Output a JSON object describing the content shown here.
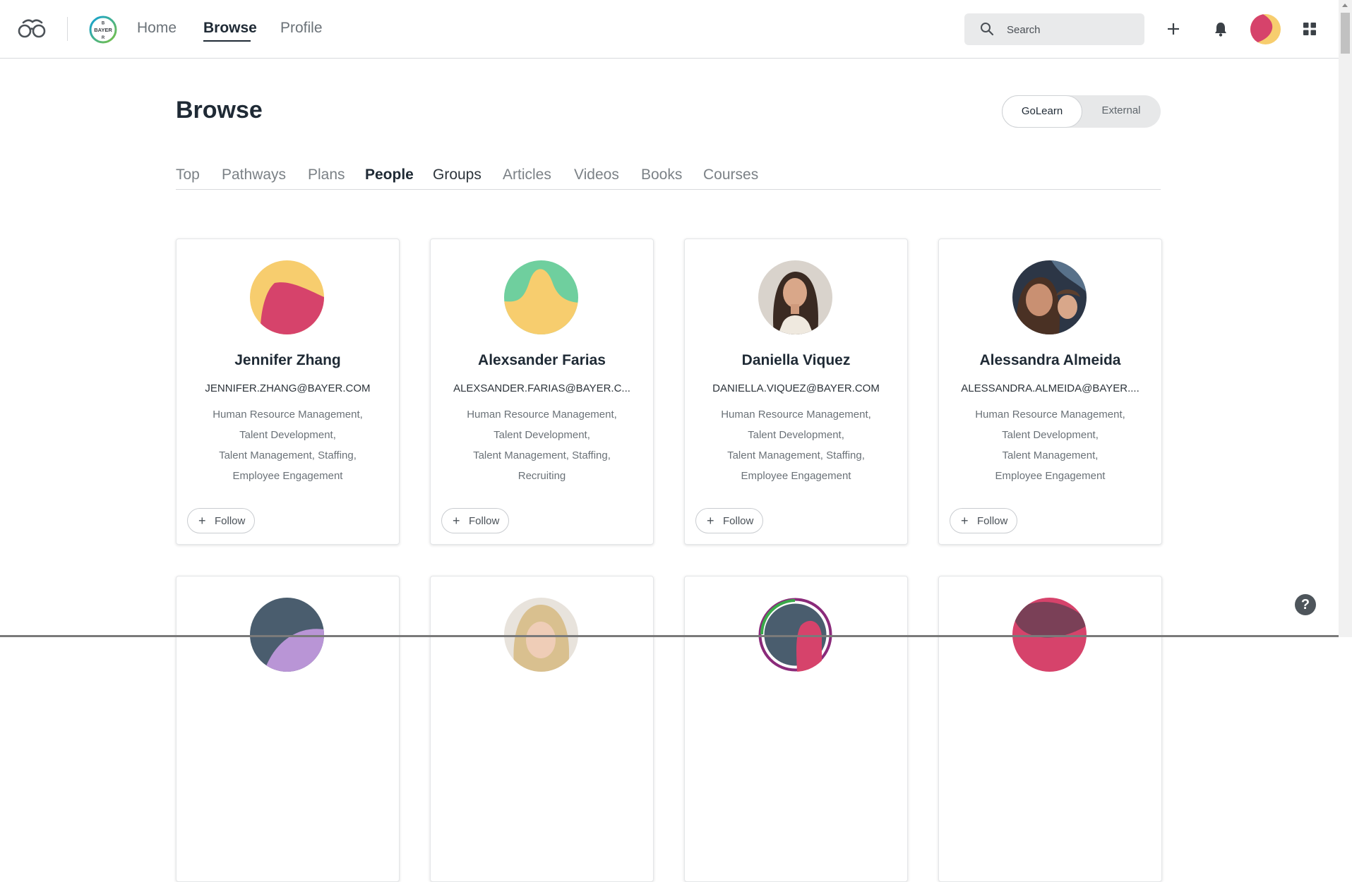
{
  "header": {
    "nav": [
      {
        "label": "Home"
      },
      {
        "label": "Browse"
      },
      {
        "label": "Profile"
      }
    ],
    "bayer_logo_text": "BAYER",
    "search": {
      "placeholder": "Search",
      "value": ""
    },
    "icons": [
      "glasses-logo-icon",
      "plus-icon",
      "bell-icon",
      "user-avatar",
      "apps-grid-icon"
    ]
  },
  "page": {
    "title": "Browse",
    "source_toggle": {
      "options": [
        "GoLearn",
        "External"
      ],
      "selected": "GoLearn"
    },
    "tabs": [
      "Top",
      "Pathways",
      "Plans",
      "People",
      "Groups",
      "Articles",
      "Videos",
      "Books",
      "Courses"
    ],
    "active_tab": "People"
  },
  "people": [
    {
      "name": "Jennifer Zhang",
      "email": "JENNIFER.ZHANG@BAYER.COM",
      "skills": [
        "Human Resource Management,",
        "Talent Development,",
        "Talent Management, Staffing,",
        "Employee Engagement"
      ],
      "follow_label": "Follow"
    },
    {
      "name": "Alexsander Farias",
      "email": "ALEXSANDER.FARIAS@BAYER.C...",
      "skills": [
        "Human Resource Management,",
        "Talent Development,",
        "Talent Management, Staffing,",
        "Recruiting"
      ],
      "follow_label": "Follow"
    },
    {
      "name": "Daniella Viquez",
      "email": "DANIELLA.VIQUEZ@BAYER.COM",
      "skills": [
        "Human Resource Management,",
        "Talent Development,",
        "Talent Management, Staffing,",
        "Employee Engagement"
      ],
      "follow_label": "Follow"
    },
    {
      "name": "Alessandra Almeida",
      "email": "ALESSANDRA.ALMEIDA@BAYER....",
      "skills": [
        "Human Resource Management,",
        "Talent Development,",
        "Talent Management,",
        "Employee Engagement"
      ],
      "follow_label": "Follow"
    }
  ],
  "help": {
    "label": "?"
  },
  "colors": {
    "text_primary": "#1f2a35",
    "text_muted": "#6b7278",
    "avatar_yellow": "#f7cd6e",
    "avatar_pink": "#d6436b",
    "avatar_green": "#6fcf9e",
    "avatar_slate": "#4a5d6e",
    "avatar_purple": "#b995d6"
  }
}
